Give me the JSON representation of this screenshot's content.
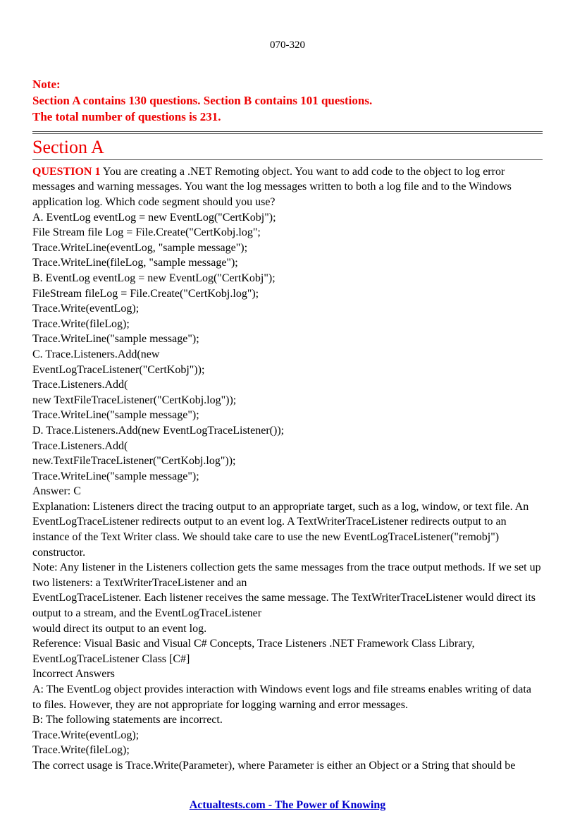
{
  "header": {
    "code": "070-320"
  },
  "note": {
    "line1": "Note:",
    "line2": "Section A contains 130 questions.  Section B contains 101 questions.",
    "line3": "The total number of questions is 231."
  },
  "section": {
    "title": "Section A"
  },
  "question": {
    "label": "QUESTION 1",
    "prompt": " You are creating a .NET Remoting object. You want to add code to the object to log error messages and warning messages. You want the log messages written to both a log file and to the Windows application log. Which code segment should you use?",
    "optA_l1": "A. EventLog eventLog = new EventLog(\"CertKobj\");",
    "optA_l2": "File Stream file Log = File.Create(\"CertKobj.log\";",
    "optA_l3": "Trace.WriteLine(eventLog, \"sample message\");",
    "optA_l4": "Trace.WriteLine(fileLog, \"sample message\");",
    "optB_l1": "B. EventLog eventLog = new EventLog(\"CertKobj\");",
    "optB_l2": "FileStream fileLog = File.Create(\"CertKobj.log\");",
    "optB_l3": "Trace.Write(eventLog);",
    "optB_l4": "Trace.Write(fileLog);",
    "optB_l5": "Trace.WriteLine(\"sample message\");",
    "optC_l1": "C. Trace.Listeners.Add(new",
    "optC_l2": "EventLogTraceListener(\"CertKobj\"));",
    "optC_l3": "Trace.Listeners.Add(",
    "optC_l4": "new TextFileTraceListener(\"CertKobj.log\"));",
    "optC_l5": "Trace.WriteLine(\"sample message\");",
    "optD_l1": "D. Trace.Listeners.Add(new EventLogTraceListener());",
    "optD_l2": "Trace.Listeners.Add(",
    "optD_l3": "new.TextFileTraceListener(\"CertKobj.log\"));",
    "optD_l4": "Trace.WriteLine(\"sample message\");",
    "answer": "Answer: C",
    "exp1": "Explanation: Listeners direct the tracing output to an appropriate target, such as a log, window, or text file. An EventLogTraceListener redirects output to an event log. A TextWriterTraceListener redirects output to an instance of the Text Writer class. We should take care to use the new EventLogTraceListener(\"remobj\") constructor.",
    "exp2": "Note: Any listener in the Listeners collection gets the same messages from the trace output methods. If we set up two listeners: a TextWriterTraceListener and an",
    "exp3": "EventLogTraceListener. Each listener receives the same message. The TextWriterTraceListener would direct its output to a stream, and the EventLogTraceListener",
    "exp4": "would direct its output to an event log.",
    "ref": "Reference: Visual Basic and Visual C# Concepts, Trace Listeners .NET Framework Class Library, EventLogTraceListener Class [C#]",
    "inc_h": "Incorrect Answers",
    "incA": "A: The EventLog object provides interaction with Windows event logs and file streams enables writing of data to files. However, they are not appropriate for logging warning and error messages.",
    "incB_l1": "B: The following statements are incorrect.",
    "incB_l2": "Trace.Write(eventLog);",
    "incB_l3": "Trace.Write(fileLog);",
    "incB_l4": "The correct usage is Trace.Write(Parameter), where Parameter is either an Object or a String that should be"
  },
  "footer": {
    "text": "Actualtests.com - The Power of Knowing"
  }
}
